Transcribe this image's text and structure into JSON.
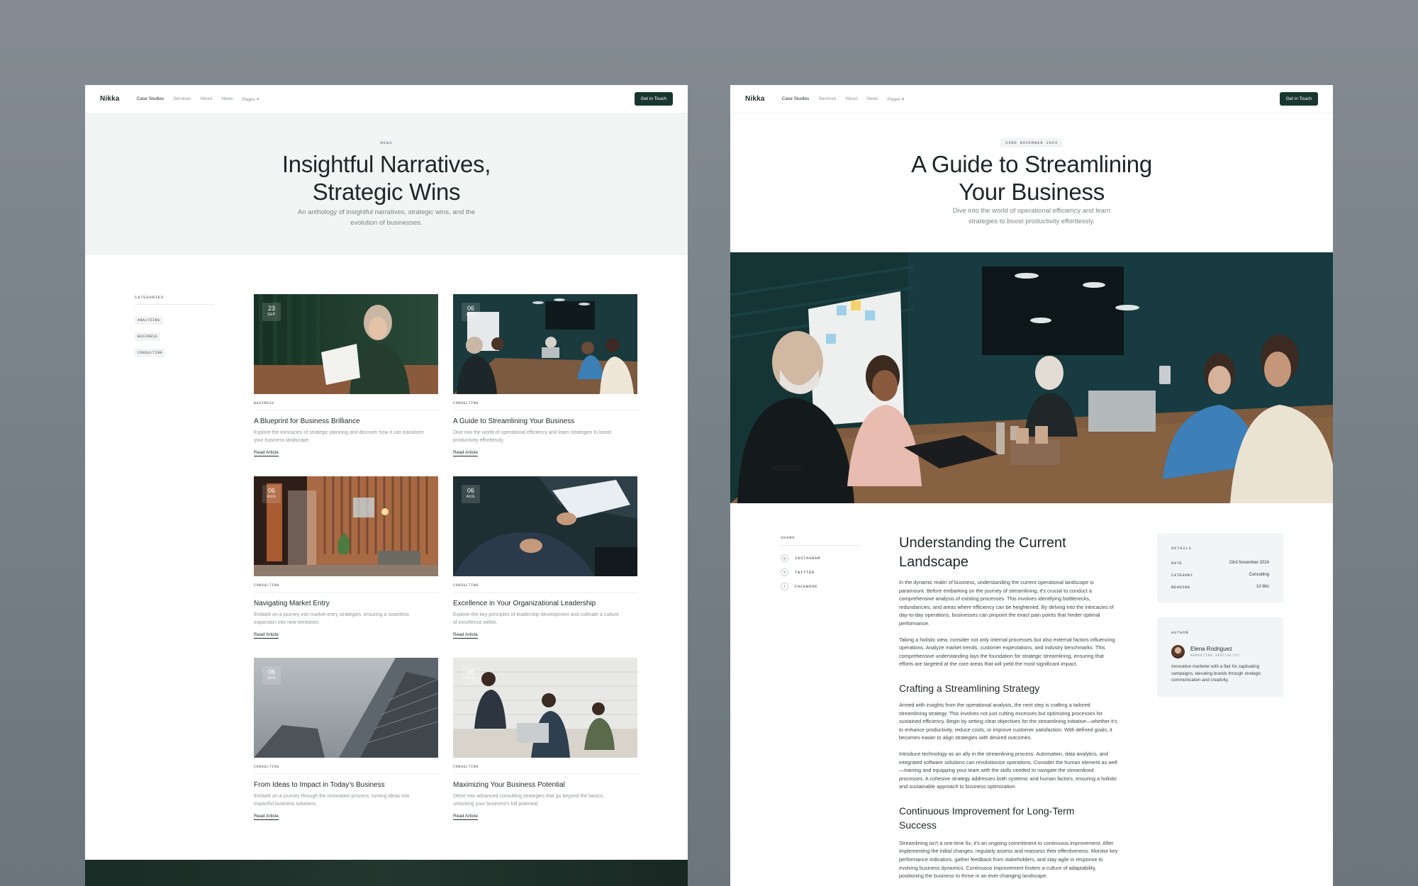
{
  "left": {
    "brand": "Nikka",
    "nav": [
      "Case Studies",
      "Services",
      "About",
      "News",
      "Pages"
    ],
    "cta": "Get in Touch",
    "hero": {
      "eyebrow": "NEWS",
      "title_line1": "Insightful Narratives,",
      "title_line2": "Strategic Wins",
      "subtitle": "An anthology of insightful narratives, strategic wins, and the evolution of businesses."
    },
    "categories": {
      "title": "CATEGORIES",
      "items": [
        "ANALYZING",
        "BUSINESS",
        "CONSULTING"
      ]
    },
    "read_more": "Read Article",
    "cards": [
      {
        "day": "23",
        "month": "SEP",
        "category": "BUSINESS",
        "title": "A Blueprint for Business Brilliance",
        "excerpt": "Explore the intricacies of strategic planning and discover how it can transform your business landscape."
      },
      {
        "day": "06",
        "month": "AUG",
        "category": "CONSULTING",
        "title": "A Guide to Streamlining Your Business",
        "excerpt": "Dive into the world of operational efficiency and learn strategies to boost productivity effortlessly."
      },
      {
        "day": "06",
        "month": "AUG",
        "category": "CONSULTING",
        "title": "Navigating Market Entry",
        "excerpt": "Embark on a journey into market entry strategies, ensuring a seamless expansion into new territories."
      },
      {
        "day": "06",
        "month": "AUG",
        "category": "CONSULTING",
        "title": "Excellence in Your Organizational Leadership",
        "excerpt": "Explore the key principles of leadership development and cultivate a culture of excellence within."
      },
      {
        "day": "06",
        "month": "AUG",
        "category": "CONSULTING",
        "title": "From Ideas to Impact in Today's Business",
        "excerpt": "Embark on a journey through the innovation process, turning ideas into impactful business solutions."
      },
      {
        "day": "06",
        "month": "AUG",
        "category": "CONSULTING",
        "title": "Maximizing Your Business Potential",
        "excerpt": "Delve into advanced consulting strategies that go beyond the basics, unlocking your business's full potential."
      }
    ]
  },
  "right": {
    "brand": "Nikka",
    "nav": [
      "Case Studies",
      "Services",
      "About",
      "News",
      "Pages"
    ],
    "cta": "Get in Touch",
    "hero": {
      "date": "23RD NOVEMBER 2024",
      "title_line1": "A Guide to Streamlining",
      "title_line2": "Your Business",
      "subtitle": "Dive into the world of operational efficiency and learn strategies to boost productivity effortlessly."
    },
    "share": {
      "title": "SHARE",
      "items": [
        "INSTAGRAM",
        "TWITTER",
        "FACEBOOK"
      ]
    },
    "article": {
      "h1": "Understanding the Current Landscape",
      "p1": "In the dynamic realm of business, understanding the current operational landscape is paramount. Before embarking on the journey of streamlining, it's crucial to conduct a comprehensive analysis of existing processes. This involves identifying bottlenecks, redundancies, and areas where efficiency can be heightened. By delving into the intricacies of day-to-day operations, businesses can pinpoint the exact pain points that hinder optimal performance.",
      "p2": "Taking a holistic view, consider not only internal processes but also external factors influencing operations. Analyze market trends, customer expectations, and industry benchmarks. This comprehensive understanding lays the foundation for strategic streamlining, ensuring that efforts are targeted at the core areas that will yield the most significant impact.",
      "h2": "Crafting a Streamlining Strategy",
      "p3": "Armed with insights from the operational analysis, the next step is crafting a tailored streamlining strategy. This involves not just cutting excesses but optimizing processes for sustained efficiency. Begin by setting clear objectives for the streamlining initiative—whether it's to enhance productivity, reduce costs, or improve customer satisfaction. With defined goals, it becomes easier to align strategies with desired outcomes.",
      "p4": "Introduce technology as an ally in the streamlining process. Automation, data analytics, and integrated software solutions can revolutionize operations. Consider the human element as well—training and equipping your team with the skills needed to navigate the streamlined processes. A cohesive strategy addresses both systemic and human factors, ensuring a holistic and sustainable approach to business optimization.",
      "h3": "Continuous Improvement for Long-Term Success",
      "p5": "Streamlining isn't a one-time fix; it's an ongoing commitment to continuous improvement. After implementing the initial changes, regularly assess and reassess their effectiveness. Monitor key performance indicators, gather feedback from stakeholders, and stay agile in response to evolving business dynamics. Continuous improvement fosters a culture of adaptability, positioning the business to thrive in an ever-changing landscape."
    },
    "details": {
      "title": "DETAILS",
      "rows": [
        {
          "key": "DATE",
          "value": "23rd November 2024"
        },
        {
          "key": "CATEGORY",
          "value": "Consulting"
        },
        {
          "key": "READING",
          "value": "10 Min"
        }
      ]
    },
    "author": {
      "title": "AUTHOR",
      "name": "Elena Rodriguez",
      "role": "MARKETING SPECIALIST",
      "bio": "Innovative marketer with a flair for captivating campaigns, elevating brands through strategic communication and creativity."
    }
  }
}
